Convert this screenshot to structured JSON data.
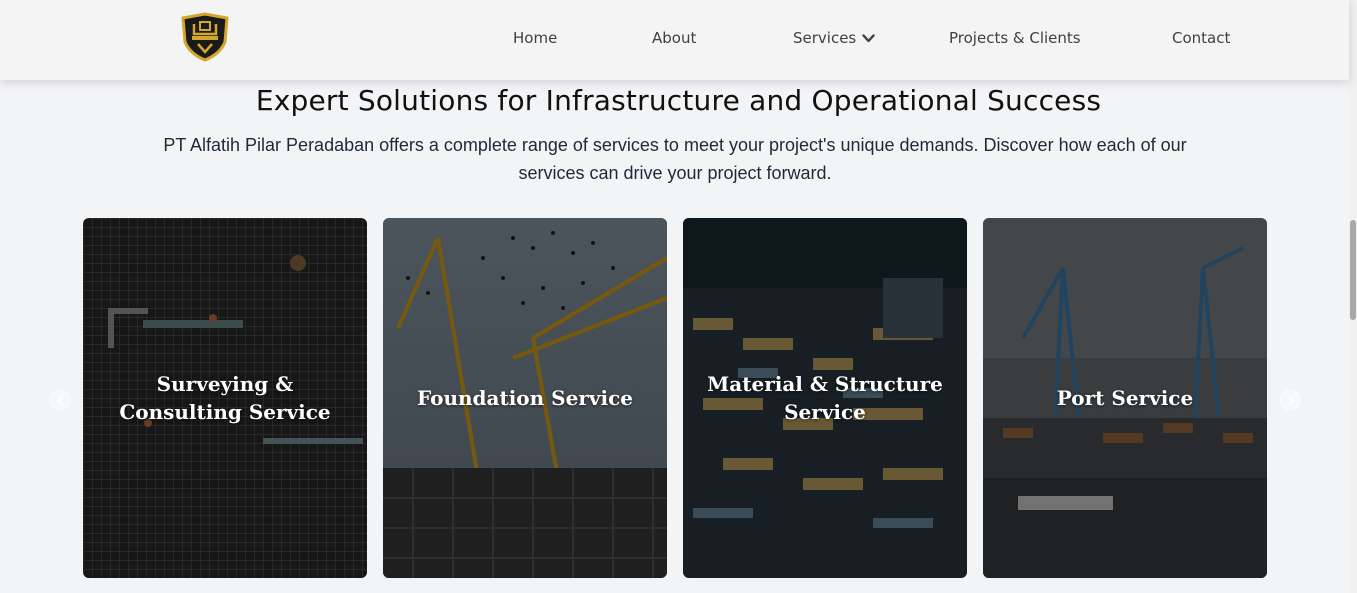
{
  "nav": {
    "home": "Home",
    "about": "About",
    "services": "Services",
    "projects": "Projects & Clients",
    "contact": "Contact"
  },
  "logo": {
    "name": "shield-logo",
    "accent": "#d4a72c"
  },
  "section": {
    "title": "Expert Solutions for Infrastructure and Operational Success",
    "lead": "PT Alfatih Pilar Peradaban offers a complete range of services to meet your project's unique demands. Discover how each of our services can drive your project forward."
  },
  "cards": [
    {
      "label": "Surveying & Consulting Service"
    },
    {
      "label": "Foundation Service"
    },
    {
      "label": "Material & Structure Service"
    },
    {
      "label": "Port Service"
    }
  ],
  "carousel": {
    "prev_icon": "chevron-left-icon",
    "next_icon": "chevron-right-icon"
  }
}
